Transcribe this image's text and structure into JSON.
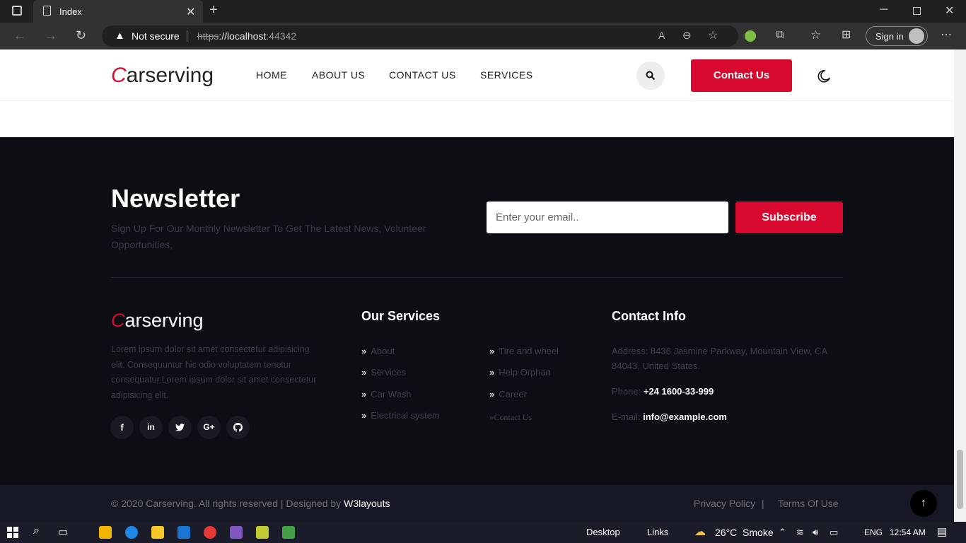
{
  "browser": {
    "tab_title": "Index",
    "security_label": "Not secure",
    "url_scheme": "https",
    "url_rest": "://localhost",
    "url_port": ":44342",
    "sign_in": "Sign in"
  },
  "nav": {
    "logo_first": "C",
    "logo_rest": "arserving",
    "links": [
      "HOME",
      "ABOUT US",
      "CONTACT US",
      "SERVICES"
    ],
    "contact_button": "Contact Us"
  },
  "newsletter": {
    "title": "Newsletter",
    "text": "Sign Up For Our Monthly Newsletter To Get The Latest News, Volunteer Opportunities,",
    "email_placeholder": "Enter your email..",
    "subscribe": "Subscribe"
  },
  "footer": {
    "logo_first": "C",
    "logo_rest": "arserving",
    "about": "Lorem ipsum dolor sit amet consectetur adipisicing elit. Consequuntur hic odio voluptatem tenetur consequatur.Lorem ipsum dolor sit amet consectetur adipisicing elit.",
    "social": [
      "f",
      "in",
      "t",
      "G+",
      "gh"
    ],
    "services_title": "Our Services",
    "services_col1": [
      "About",
      "Services",
      "Car Wash",
      "Electrical system"
    ],
    "services_col2": [
      "Tire and wheel",
      "Help Orphan",
      "Career",
      "Contact Us"
    ],
    "contact_title": "Contact Info",
    "address_label": "Address: 8436 Jasmine Parkway, Mountain View, CA 84043, United States.",
    "phone_label": "Phone:",
    "phone": "+24 1600-33-999",
    "email_label": "E-mail:",
    "email": "info@example.com"
  },
  "bottom": {
    "copyright": "© 2020 Carserving. All rights reserved | Designed by",
    "designer": "W3layouts",
    "privacy": "Privacy Policy",
    "separator": "|",
    "terms": "Terms Of Use"
  },
  "taskbar": {
    "desktop": "Desktop",
    "links": "Links",
    "weather": "26°C  Smoke",
    "lang": "ENG",
    "time": "12:54 AM"
  },
  "colors": {
    "accent": "#d8092f",
    "footer_bg": "#0d0e14",
    "bottom_bg": "#171825"
  }
}
